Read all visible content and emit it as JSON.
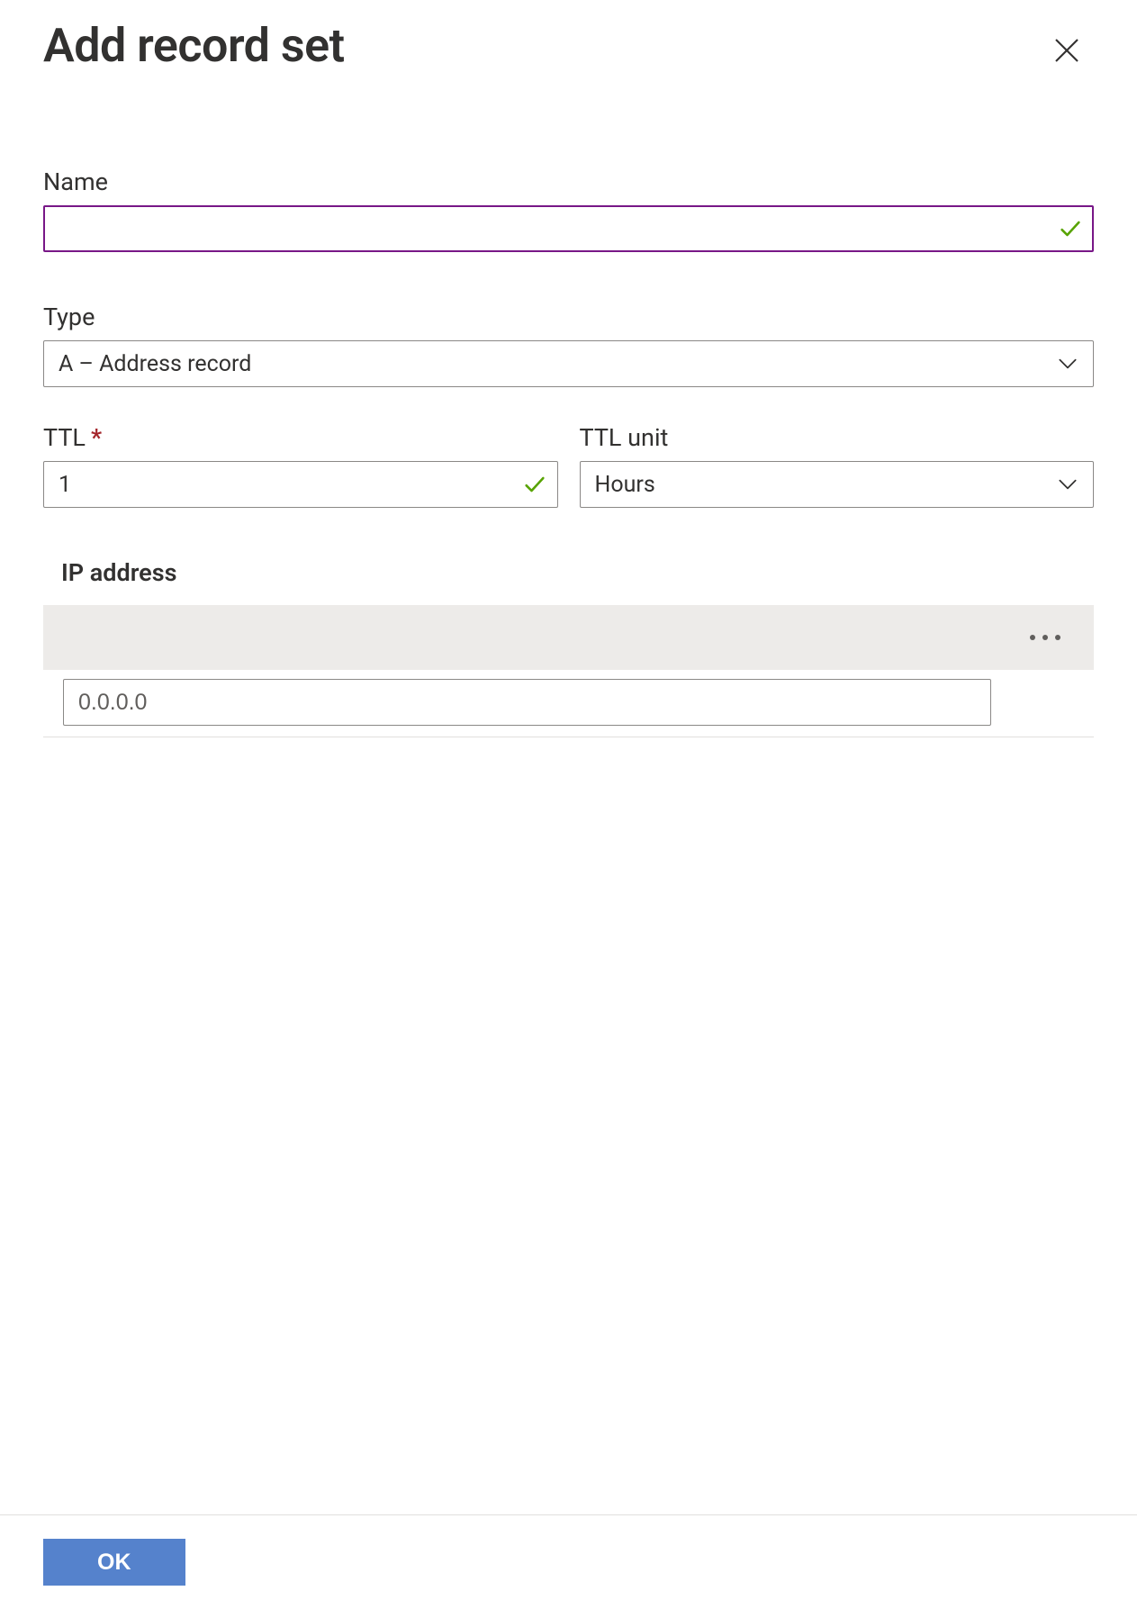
{
  "header": {
    "title": "Add record set"
  },
  "fields": {
    "name": {
      "label": "Name",
      "value": ""
    },
    "type": {
      "label": "Type",
      "value": "A – Address record"
    },
    "ttl": {
      "label": "TTL",
      "required_marker": "*",
      "value": "1"
    },
    "ttl_unit": {
      "label": "TTL unit",
      "value": "Hours"
    },
    "ip_section": {
      "heading": "IP address",
      "input_placeholder": "0.0.0.0",
      "input_value": ""
    }
  },
  "footer": {
    "ok_label": "OK"
  }
}
